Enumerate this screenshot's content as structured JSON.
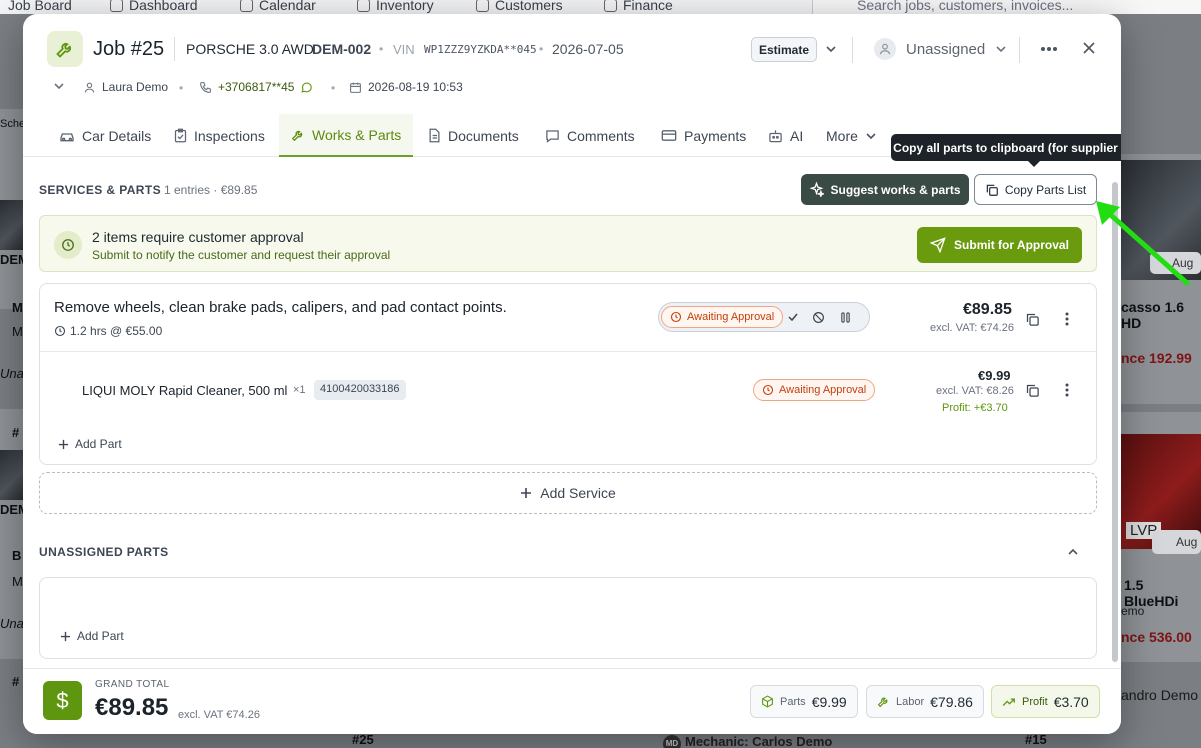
{
  "bg_nav": {
    "items": [
      "Job Board",
      "Dashboard",
      "Calendar",
      "Inventory",
      "Customers",
      "Finance"
    ],
    "search_placeholder": "Search jobs, customers, invoices..."
  },
  "bg_cards": {
    "left_texts": [
      "Sche",
      "DEM",
      "M",
      "M",
      "Unas",
      "#",
      "DEM",
      "B",
      "M",
      "Unas",
      "#"
    ],
    "right_texts": {
      "aug1": "Aug",
      "car1": "casso 1.6 HD",
      "balance1": "nce 192.99",
      "aug2": "Aug",
      "plate2": "LVP",
      "car2": "1.5 BlueHDi",
      "owner2": "emo",
      "balance2": "nce 536.00",
      "owner3": "andro Demo"
    },
    "bottom": {
      "job": "#25",
      "mechanic": "Mechanic: Carlos Demo",
      "job2": "#15",
      "initials": "MD"
    }
  },
  "header": {
    "title": "Job #25",
    "car": "PORSCHE 3.0 AWD",
    "plate": "DEM-002",
    "vin_label": "VIN",
    "vin": "WP1ZZZ9YZKDA**045",
    "date": "2026-07-05",
    "estimate_label": "Estimate",
    "assignee": "Unassigned",
    "customer": "Laura Demo",
    "phone": "+3706817**45",
    "datetime": "2026-08-19 10:53"
  },
  "tabs": [
    "Car Details",
    "Inspections",
    "Works & Parts",
    "Documents",
    "Comments",
    "Payments",
    "AI",
    "More"
  ],
  "tooltip": "Copy all parts to clipboard (for supplier ordering)",
  "services": {
    "title": "SERVICES & PARTS",
    "meta": "1 entries · €89.85",
    "suggest_label": "Suggest works & parts",
    "copy_label": "Copy Parts List"
  },
  "approval": {
    "title": "2 items require customer approval",
    "subtitle": "Submit to notify the customer and request their approval",
    "button": "Submit for Approval"
  },
  "service_item": {
    "name": "Remove wheels, clean brake pads, calipers, and pad contact points.",
    "time": "1.2 hrs @ €55.00",
    "status": "Awaiting Approval",
    "price": "€89.85",
    "excl": "excl. VAT: €74.26"
  },
  "part_item": {
    "name": "LIQUI MOLY Rapid Cleaner, 500 ml",
    "qty": "×1",
    "sku": "4100420033186",
    "status": "Awaiting Approval",
    "price": "€9.99",
    "excl": "excl. VAT: €8.26",
    "profit": "Profit: +€3.70"
  },
  "add_part_label": "Add Part",
  "add_service_label": "Add Service",
  "unassigned": {
    "title": "UNASSIGNED PARTS",
    "add_part_label": "Add Part"
  },
  "footer": {
    "grand_label": "GRAND TOTAL",
    "grand_total": "€89.85",
    "excl": "excl. VAT €74.26",
    "dollar": "$",
    "parts_label": "Parts",
    "parts_value": "€9.99",
    "labor_label": "Labor",
    "labor_value": "€79.86",
    "profit_label": "Profit",
    "profit_value": "€3.70"
  },
  "colors": {
    "brand_green": "#6a9a0e",
    "awaiting": "#c2410c",
    "profit": "#5e960f",
    "arrow": "#22dd11"
  }
}
